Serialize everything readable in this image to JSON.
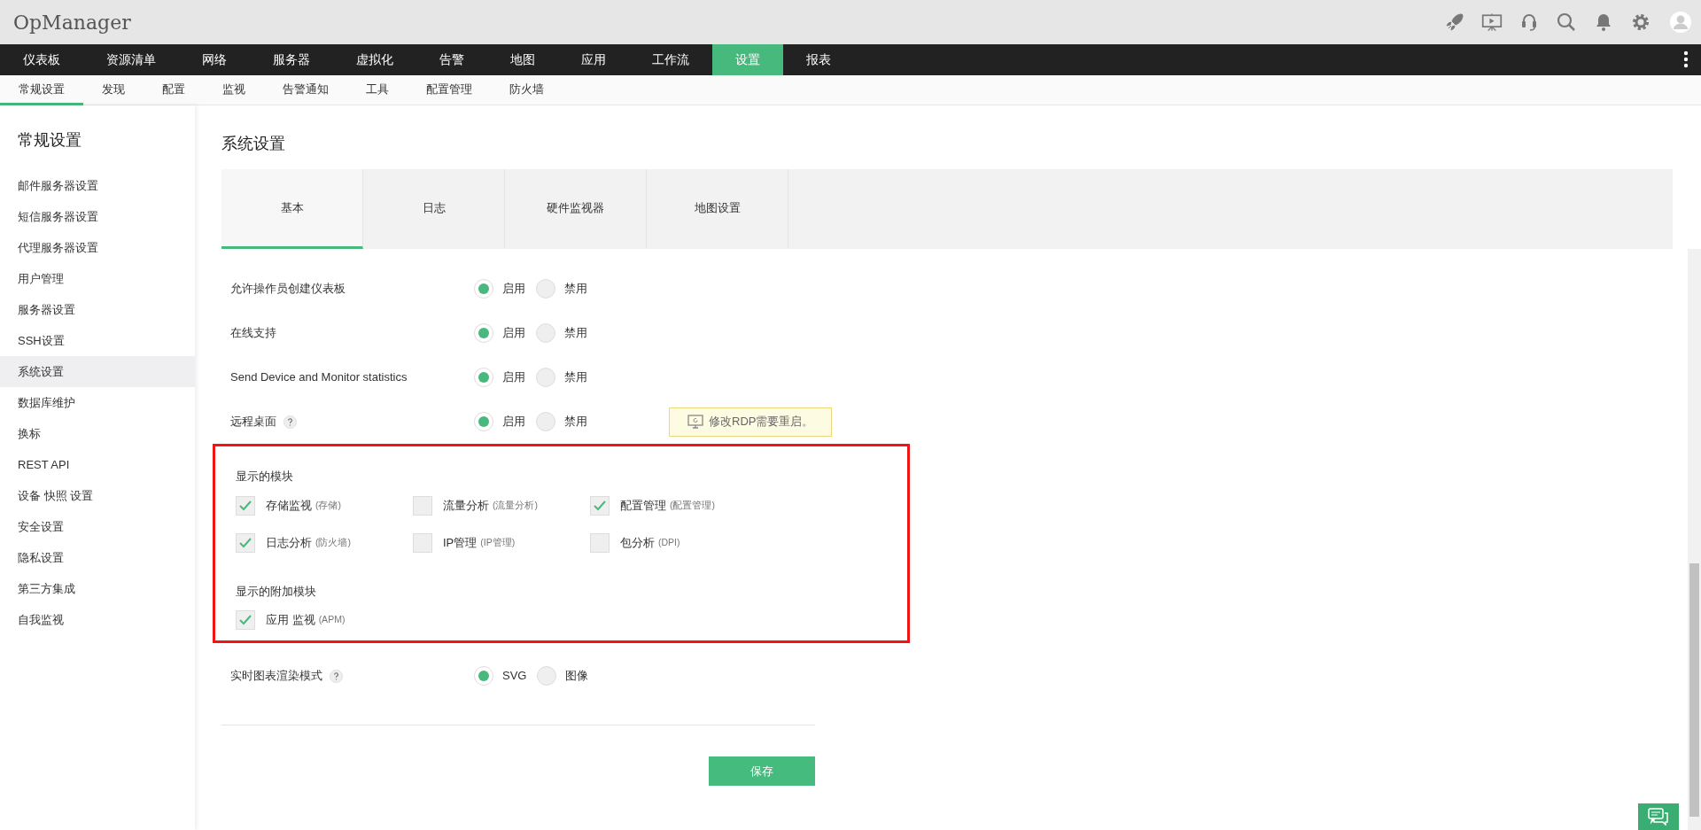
{
  "app": {
    "logo": "OpManager"
  },
  "main_nav": [
    {
      "label": "仪表板",
      "selected": false
    },
    {
      "label": "资源清单",
      "selected": false
    },
    {
      "label": "网络",
      "selected": false
    },
    {
      "label": "服务器",
      "selected": false
    },
    {
      "label": "虚拟化",
      "selected": false
    },
    {
      "label": "告警",
      "selected": false
    },
    {
      "label": "地图",
      "selected": false
    },
    {
      "label": "应用",
      "selected": false
    },
    {
      "label": "工作流",
      "selected": false
    },
    {
      "label": "设置",
      "selected": true
    },
    {
      "label": "报表",
      "selected": false
    }
  ],
  "sub_nav": [
    {
      "label": "常规设置",
      "selected": true
    },
    {
      "label": "发现",
      "selected": false
    },
    {
      "label": "配置",
      "selected": false
    },
    {
      "label": "监视",
      "selected": false
    },
    {
      "label": "告警通知",
      "selected": false
    },
    {
      "label": "工具",
      "selected": false
    },
    {
      "label": "配置管理",
      "selected": false
    },
    {
      "label": "防火墙",
      "selected": false
    }
  ],
  "sidebar": {
    "title": "常规设置",
    "items": [
      {
        "label": "邮件服务器设置",
        "selected": false
      },
      {
        "label": "短信服务器设置",
        "selected": false
      },
      {
        "label": "代理服务器设置",
        "selected": false
      },
      {
        "label": "用户管理",
        "selected": false
      },
      {
        "label": "服务器设置",
        "selected": false
      },
      {
        "label": "SSH设置",
        "selected": false
      },
      {
        "label": "系统设置",
        "selected": true
      },
      {
        "label": "数据库维护",
        "selected": false
      },
      {
        "label": "换标",
        "selected": false
      },
      {
        "label": "REST API",
        "selected": false
      },
      {
        "label": "设备 快照 设置",
        "selected": false
      },
      {
        "label": "安全设置",
        "selected": false
      },
      {
        "label": "隐私设置",
        "selected": false
      },
      {
        "label": "第三方集成",
        "selected": false
      },
      {
        "label": "自我监视",
        "selected": false
      }
    ]
  },
  "page": {
    "title": "系统设置",
    "tabs": [
      {
        "label": "基本",
        "selected": true
      },
      {
        "label": "日志",
        "selected": false
      },
      {
        "label": "硬件监视器",
        "selected": false
      },
      {
        "label": "地图设置",
        "selected": false
      }
    ],
    "settings": [
      {
        "label": "允许操作员创建仪表板",
        "help": false,
        "options": [
          {
            "label": "启用",
            "selected": true
          },
          {
            "label": "禁用",
            "selected": false
          }
        ]
      },
      {
        "label": "在线支持",
        "help": false,
        "options": [
          {
            "label": "启用",
            "selected": true
          },
          {
            "label": "禁用",
            "selected": false
          }
        ]
      },
      {
        "label": "Send Device and Monitor statistics",
        "help": false,
        "options": [
          {
            "label": "启用",
            "selected": true
          },
          {
            "label": "禁用",
            "selected": false
          }
        ]
      },
      {
        "label": "远程桌面",
        "help": true,
        "options": [
          {
            "label": "启用",
            "selected": true
          },
          {
            "label": "禁用",
            "selected": false
          }
        ],
        "tooltip": "修改RDP需要重启。"
      }
    ],
    "module_groups": [
      {
        "title": "显示的模块",
        "items": [
          {
            "label": "存储监视",
            "note": "(存储)",
            "checked": true
          },
          {
            "label": "流量分析",
            "note": "(流量分析)",
            "checked": false
          },
          {
            "label": "配置管理",
            "note": "(配置管理)",
            "checked": true
          },
          {
            "label": "日志分析",
            "note": "(防火墙)",
            "checked": true
          },
          {
            "label": "IP管理",
            "note": "(IP管理)",
            "checked": false
          },
          {
            "label": "包分析",
            "note": "(DPI)",
            "checked": false
          }
        ]
      },
      {
        "title": "显示的附加模块",
        "items": [
          {
            "label": "应用 监视",
            "note": "(APM)",
            "checked": true
          }
        ]
      }
    ],
    "settings_after": [
      {
        "label": "实时图表渲染模式",
        "help": true,
        "options": [
          {
            "label": "SVG",
            "selected": true
          },
          {
            "label": "图像",
            "selected": false
          }
        ]
      }
    ],
    "save_button": "保存"
  }
}
